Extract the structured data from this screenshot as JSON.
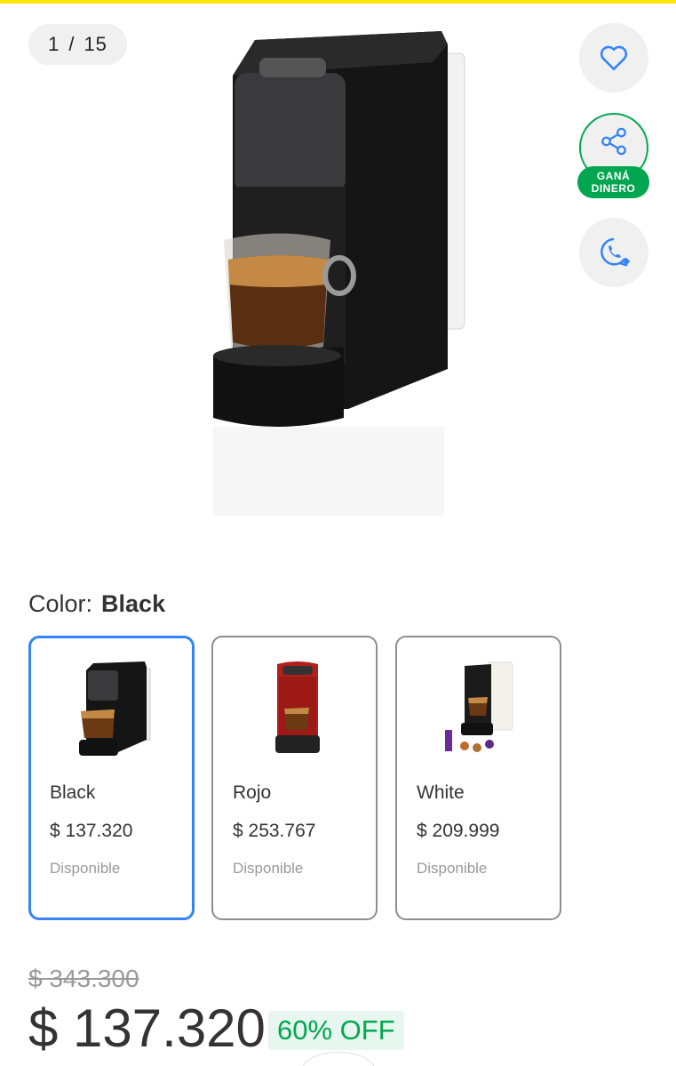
{
  "gallery": {
    "current": "1",
    "separator": "/",
    "total": "15"
  },
  "actions": {
    "favorite_icon": "heart-icon",
    "share_icon": "share-icon",
    "share_badge_line1": "GANÁ",
    "share_badge_line2": "DINERO",
    "whatsapp_icon": "whatsapp-icon"
  },
  "color_picker": {
    "label": "Color:",
    "selected": "Black",
    "variants": [
      {
        "name": "Black",
        "price": "$ 137.320",
        "stock": "Disponible",
        "selected": true
      },
      {
        "name": "Rojo",
        "price": "$ 253.767",
        "stock": "Disponible",
        "selected": false
      },
      {
        "name": "White",
        "price": "$ 209.999",
        "stock": "Disponible",
        "selected": false
      }
    ]
  },
  "pricing": {
    "original_price": "$ 343.300",
    "current_price": "$ 137.320",
    "discount": "60% OFF"
  },
  "colors": {
    "accent_blue": "#3483fa",
    "green": "#00a650",
    "top_bar_yellow": "#fee600"
  }
}
